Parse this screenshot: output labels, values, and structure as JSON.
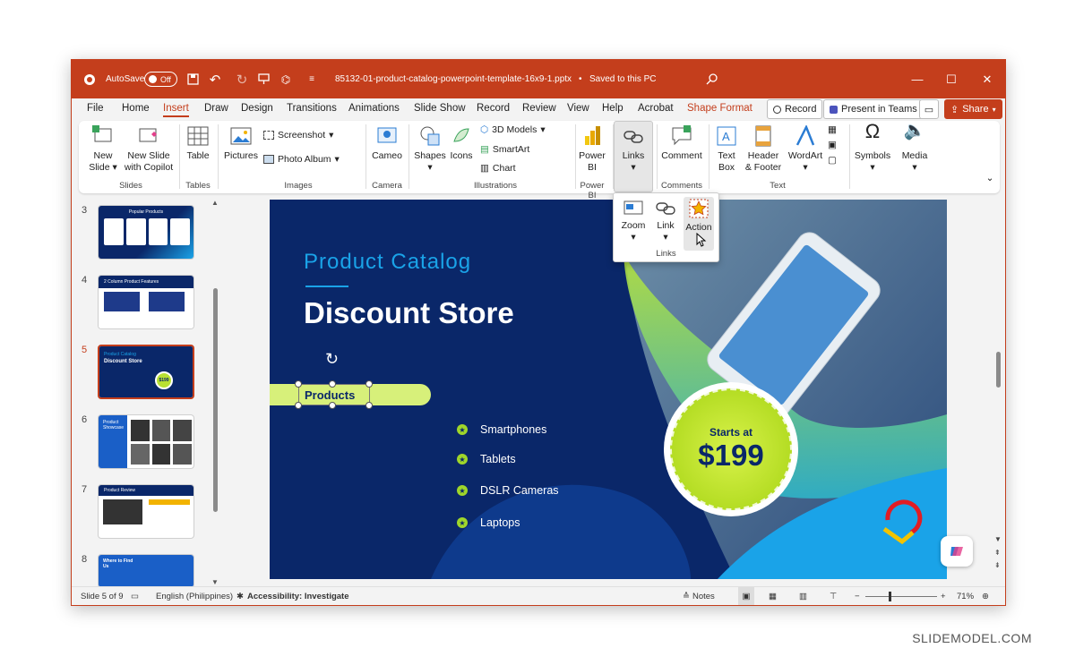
{
  "titlebar": {
    "autosave": "AutoSave",
    "toggle": "Off",
    "filename": "85132-01-product-catalog-powerpoint-template-16x9-1.pptx",
    "saved": "Saved to this PC",
    "dash": "•"
  },
  "tabs": [
    "File",
    "Home",
    "Insert",
    "Draw",
    "Design",
    "Transitions",
    "Animations",
    "Slide Show",
    "Record",
    "Review",
    "View",
    "Help",
    "Acrobat",
    "Shape Format"
  ],
  "tab_buttons": {
    "record": "Record",
    "teams": "Present in Teams",
    "share": "Share"
  },
  "ribbon": {
    "new_slide": "New Slide",
    "new_slide_copilot": "New Slide with Copilot",
    "grp_slides": "Slides",
    "table": "Table",
    "grp_tables": "Tables",
    "pictures": "Pictures",
    "screenshot": "Screenshot",
    "photo_album": "Photo Album",
    "grp_images": "Images",
    "cameo": "Cameo",
    "grp_camera": "Camera",
    "shapes": "Shapes",
    "icons": "Icons",
    "models3d": "3D Models",
    "smartart": "SmartArt",
    "chart": "Chart",
    "grp_illus": "Illustrations",
    "powerbi": "Power BI",
    "grp_powerbi": "Power BI",
    "links": "Links",
    "comment": "Comment",
    "grp_comments": "Comments",
    "textbox": "Text Box",
    "header_footer": "Header & Footer",
    "wordart": "WordArt",
    "grp_text": "Text",
    "symbols": "Symbols",
    "media": "Media"
  },
  "links_popup": {
    "zoom": "Zoom",
    "link": "Link",
    "action": "Action",
    "group": "Links"
  },
  "thumbnails": [
    {
      "num": "3",
      "title": "Popular Products"
    },
    {
      "num": "4",
      "title": "2 Column Product Features"
    },
    {
      "num": "5",
      "title": "Product Catalog",
      "subtitle": "Discount Store",
      "price": "$199"
    },
    {
      "num": "6",
      "title": "Product Showcase"
    },
    {
      "num": "7",
      "title": "Product Review"
    },
    {
      "num": "8",
      "title": "Where to Find Us"
    }
  ],
  "slide": {
    "kicker": "Product Catalog",
    "title": "Discount Store",
    "tag": "Products",
    "bullets": [
      "Smartphones",
      "Tablets",
      "DSLR Cameras",
      "Laptops"
    ],
    "starts_at": "Starts at",
    "price": "$199"
  },
  "status": {
    "slide": "Slide 5 of 9",
    "language": "English (Philippines)",
    "accessibility": "Accessibility: Investigate",
    "notes": "Notes",
    "zoom": "71%"
  },
  "watermark": "SLIDEMODEL.COM",
  "colors": {
    "accent": "#c43e1c",
    "slide_bg": "#0a2769",
    "lime": "#9fd62a",
    "cyan": "#1aa3e8"
  }
}
